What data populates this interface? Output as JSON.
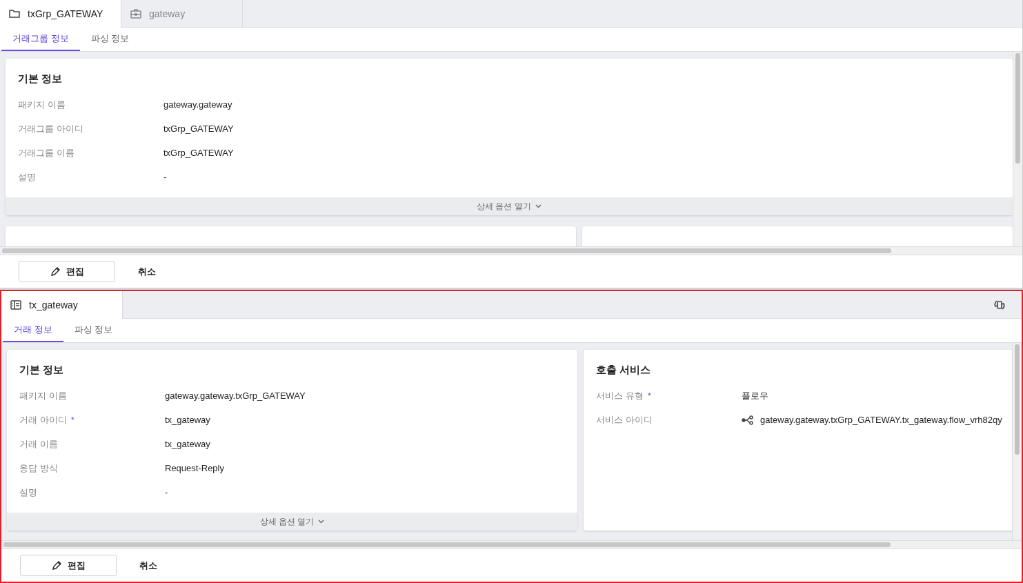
{
  "panes": [
    {
      "highlighted": false,
      "sync_button": false,
      "tabs": [
        {
          "label": "txGrp_GATEWAY",
          "kind": "folder",
          "selected": true
        },
        {
          "label": "gateway",
          "kind": "briefcase",
          "selected": false
        }
      ],
      "subtabs": [
        {
          "label": "거래그룹 정보",
          "selected": true
        },
        {
          "label": "파싱 정보",
          "selected": false
        }
      ],
      "rows": [
        [
          {
            "kind": "info",
            "title": "기본 정보",
            "expand_label": "상세 옵션 열기",
            "fields": [
              {
                "label": "패키지 이름",
                "value": "gateway.gateway"
              },
              {
                "label": "거래그룹 아이디",
                "value": "txGrp_GATEWAY"
              },
              {
                "label": "거래그룹 이름",
                "value": "txGrp_GATEWAY"
              },
              {
                "label": "설명",
                "value": "-"
              }
            ]
          }
        ],
        [
          {
            "kind": "stub"
          },
          {
            "kind": "stub"
          }
        ]
      ],
      "buttons": {
        "edit": "편집",
        "cancel": "취소"
      }
    },
    {
      "highlighted": true,
      "sync_button": true,
      "tabs": [
        {
          "label": "tx_gateway",
          "kind": "table",
          "selected": true
        }
      ],
      "subtabs": [
        {
          "label": "거래 정보",
          "selected": true
        },
        {
          "label": "파싱 정보",
          "selected": false
        }
      ],
      "rows": [
        [
          {
            "kind": "info",
            "title": "기본 정보",
            "expand_label": "상세 옵션 열기",
            "fields": [
              {
                "label": "패키지 이름",
                "value": "gateway.gateway.txGrp_GATEWAY"
              },
              {
                "label": "거래 아이디",
                "mark": "*",
                "value": "tx_gateway"
              },
              {
                "label": "거래 이름",
                "value": "tx_gateway"
              },
              {
                "label": "응답 방식",
                "value": "Request-Reply"
              },
              {
                "label": "설명",
                "value": "-"
              }
            ]
          },
          {
            "kind": "info",
            "title": "호출 서비스",
            "fields": [
              {
                "label": "서비스 유형",
                "mark": "*",
                "value": "플로우"
              },
              {
                "label": "서비스 아이디",
                "kind": "flow",
                "value": "gateway.gateway.txGrp_GATEWAY.tx_gateway.flow_vrh82qy"
              }
            ]
          }
        ]
      ],
      "buttons": {
        "edit": "편집",
        "cancel": "취소"
      }
    }
  ]
}
